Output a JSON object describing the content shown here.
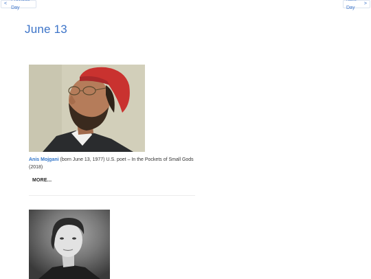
{
  "nav": {
    "prev_label": "Previous Day",
    "next_label": "Next Day",
    "prev_icon": "chevron-left-icon",
    "next_icon": "chevron-right-icon",
    "prev_glyph": "<",
    "next_glyph": ">"
  },
  "page": {
    "title": "June 13",
    "accent_color": "#3b73c8"
  },
  "entries": [
    {
      "name": "Anis Mojgani",
      "description": " (born June 13, 1977) U.S. poet – In the Pockets of Small Gods (2018)",
      "more_label": "MORE..."
    },
    {
      "name": "",
      "description": "",
      "more_label": ""
    }
  ]
}
